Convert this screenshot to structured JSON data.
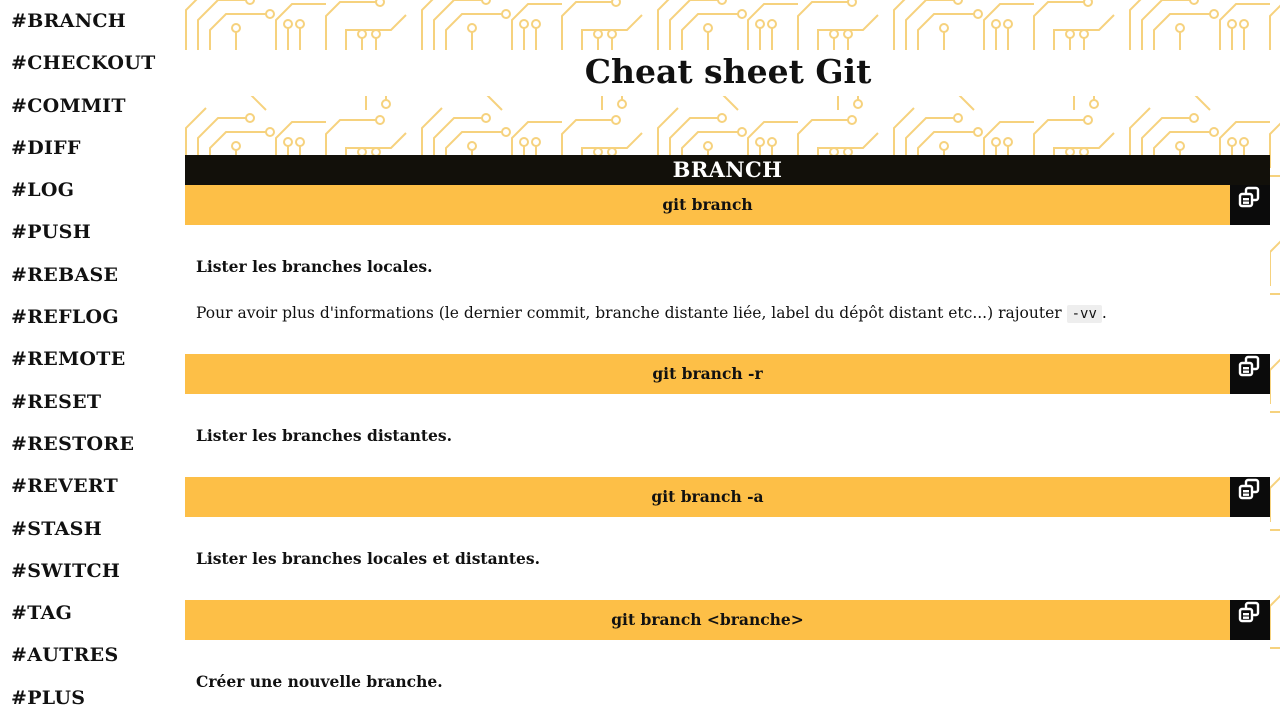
{
  "sidebar": {
    "items": [
      {
        "label": "#BRANCH"
      },
      {
        "label": "#CHECKOUT"
      },
      {
        "label": "#COMMIT"
      },
      {
        "label": "#DIFF"
      },
      {
        "label": "#LOG"
      },
      {
        "label": "#PUSH"
      },
      {
        "label": "#REBASE"
      },
      {
        "label": "#REFLOG"
      },
      {
        "label": "#REMOTE"
      },
      {
        "label": "#RESET"
      },
      {
        "label": "#RESTORE"
      },
      {
        "label": "#REVERT"
      },
      {
        "label": "#STASH"
      },
      {
        "label": "#SWITCH"
      },
      {
        "label": "#TAG"
      },
      {
        "label": "#AUTRES"
      },
      {
        "label": "#PLUS"
      }
    ]
  },
  "header": {
    "title": "Cheat sheet Git"
  },
  "section": {
    "title": "BRANCH",
    "commands": [
      {
        "command": "git branch",
        "description": "Lister les branches locales.",
        "detail_before": "Pour avoir plus d'informations (le dernier commit, branche distante liée, label du dépôt distant etc...) rajouter ",
        "detail_code": "-vv",
        "detail_after": "."
      },
      {
        "command": "git branch -r",
        "description": "Lister les branches distantes."
      },
      {
        "command": "git branch -a",
        "description": "Lister les branches locales et distantes."
      },
      {
        "command": "git branch <branche>",
        "description": "Créer une nouvelle branche."
      }
    ]
  },
  "icons": {
    "copy": "copy-icon"
  },
  "colors": {
    "accent": "#fdbf47",
    "dark": "#12100a",
    "circuit": "#f6d27e"
  }
}
